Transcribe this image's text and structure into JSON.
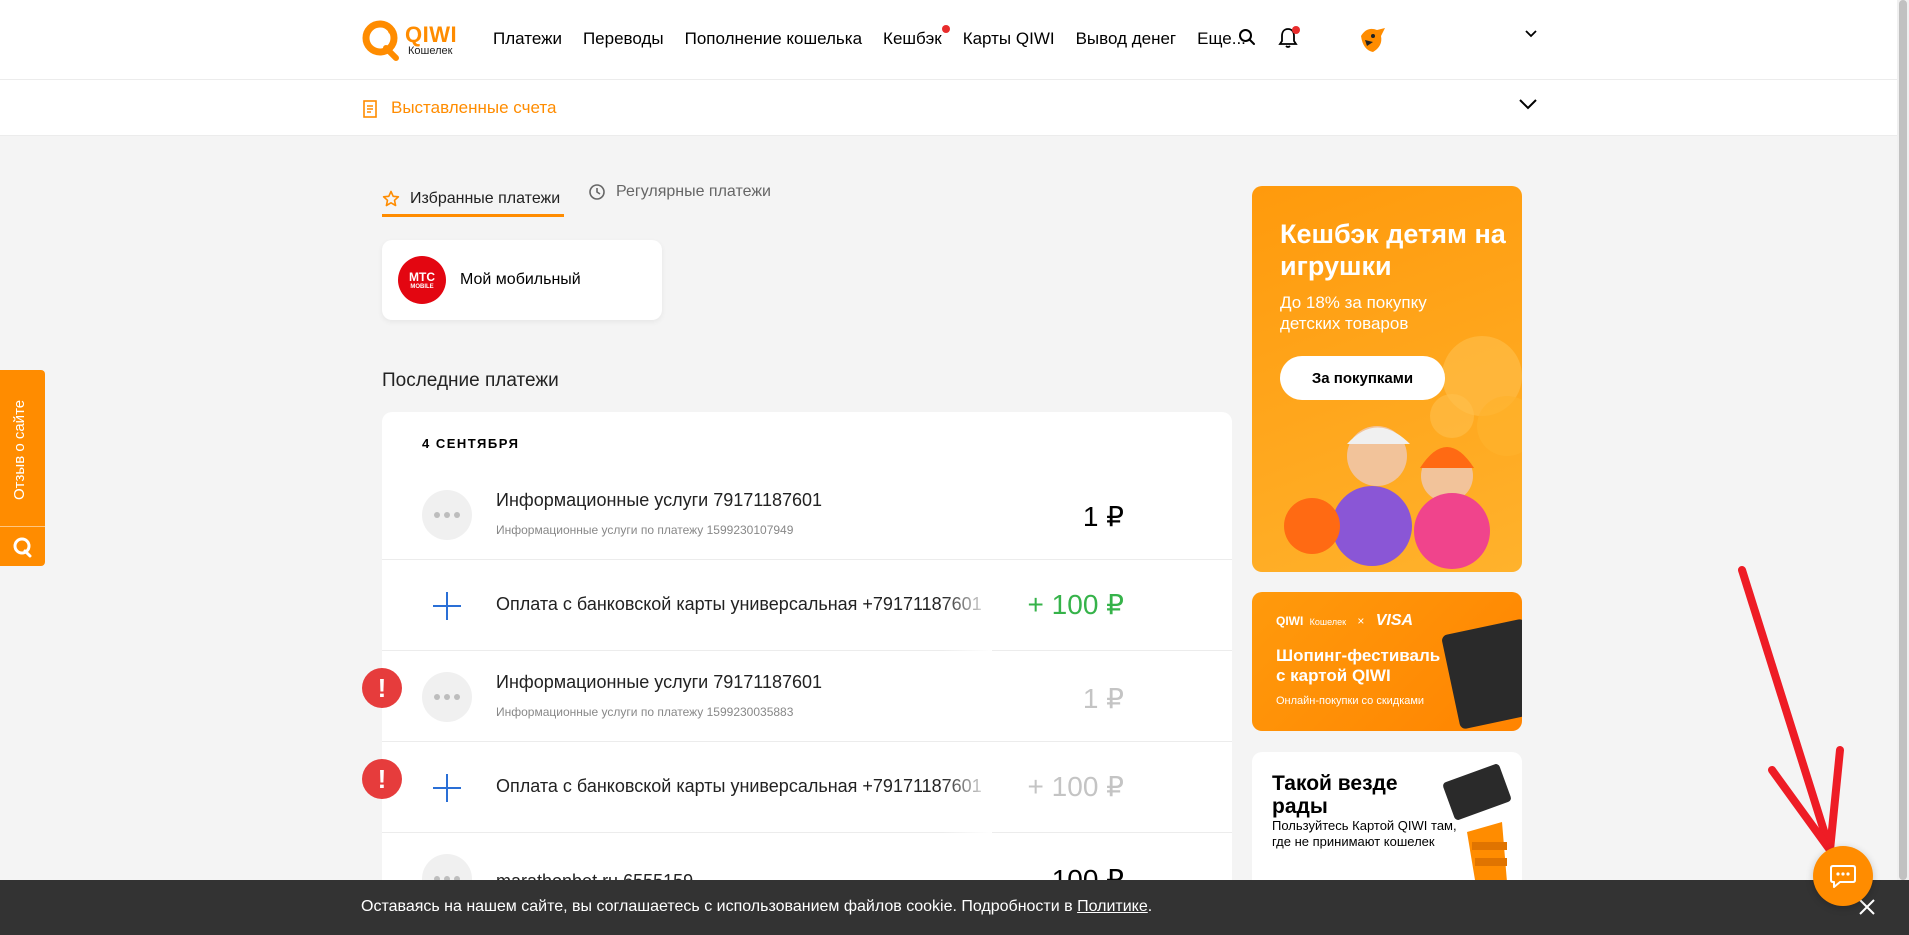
{
  "header": {
    "logo_brand": "QIWI",
    "logo_sub": "Кошелек",
    "nav": [
      {
        "label": "Платежи",
        "dot": false
      },
      {
        "label": "Переводы",
        "dot": false
      },
      {
        "label": "Пополнение кошелька",
        "dot": false
      },
      {
        "label": "Кешбэк",
        "dot": true
      },
      {
        "label": "Карты QIWI",
        "dot": false
      },
      {
        "label": "Вывод денег",
        "dot": false
      },
      {
        "label": "Еще...",
        "dot": false
      }
    ]
  },
  "subbar": {
    "label": "Выставленные счета"
  },
  "tabs": {
    "favorites": "Избранные платежи",
    "regular": "Регулярные платежи"
  },
  "favorite": {
    "logo_text": "МТС",
    "logo_sub": "MOBILE",
    "name": "Мой мобильный"
  },
  "recent": {
    "title": "Последние платежи",
    "date": "4 СЕНТЯБРЯ",
    "rows": [
      {
        "title": "Информационные услуги 79171187601",
        "subtitle": "Информационные услуги по платежу 1599230107949",
        "amount": "1 ₽",
        "status": "ok",
        "type": "dots"
      },
      {
        "title": "Оплата с банковской карты универсальная +79171187601",
        "subtitle": "",
        "amount": "+ 100 ₽",
        "status": "ok",
        "type": "plus"
      },
      {
        "title": "Информационные услуги 79171187601",
        "subtitle": "Информационные услуги по платежу 1599230035883",
        "amount": "1 ₽",
        "status": "error",
        "type": "dots"
      },
      {
        "title": "Оплата с банковской карты универсальная +79171187601",
        "subtitle": "",
        "amount": "+ 100 ₽",
        "status": "error",
        "type": "plus"
      },
      {
        "title": "marathonbet.ru 6555159",
        "subtitle": "",
        "amount": "100 ₽",
        "status": "ok",
        "type": "dots"
      }
    ]
  },
  "banners": {
    "b1": {
      "heading": "Кешбэк детям на игрушки",
      "text": "До 18% за покупку детских товаров",
      "button": "За покупками"
    },
    "b2": {
      "brand": "QIWI",
      "brand_sub": "Кошелек",
      "partner": "VISA",
      "heading": "Шопинг-фестиваль с картой QIWI",
      "text": "Онлайн-покупки со скидками"
    },
    "b3": {
      "heading": "Такой везде рады",
      "text": "Пользуйтесь Картой QIWI там, где не принимают кошелек"
    }
  },
  "feedback_tab": "Отзыв о сайте",
  "cookie": {
    "text": "Оставаясь на нашем сайте, вы соглашаетесь с использованием файлов cookie. Подробности в ",
    "link": "Политике",
    "end": "."
  },
  "colors": {
    "accent": "#ff8c00",
    "positive": "#36b34a",
    "error": "#e63c3c",
    "annotation": "#ee1c25"
  }
}
